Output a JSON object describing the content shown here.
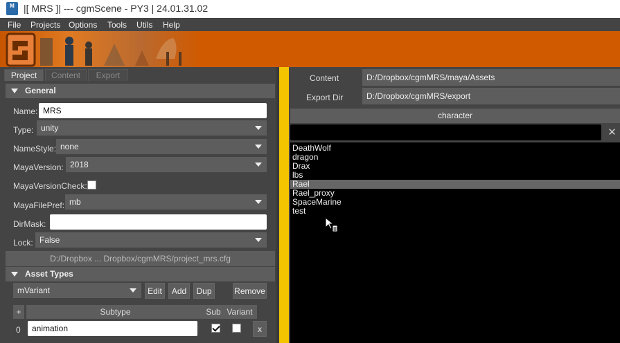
{
  "window": {
    "app_icon_text": "M",
    "title": "|[ MRS ]| --- cgmScene - PY3 | 24.01.31.02"
  },
  "menu": [
    "File",
    "Projects",
    "Options",
    "Tools",
    "Utils",
    "Help"
  ],
  "tabs": [
    "Project",
    "Content",
    "Export"
  ],
  "general": {
    "header": "General",
    "name_label": "Name:",
    "name_value": "MRS",
    "type_label": "Type:",
    "type_value": "unity",
    "namestyle_label": "NameStyle:",
    "namestyle_value": "none",
    "mayaversion_label": "MayaVersion:",
    "mayaversion_value": "2018",
    "mayaversioncheck_label": "MayaVersionCheck:",
    "mayafilepref_label": "MayaFilePref:",
    "mayafilepref_value": "mb",
    "dirmask_label": "DirMask:",
    "dirmask_value": "",
    "lock_label": "Lock:",
    "lock_value": "False",
    "config_path": "D:/Dropbox ... Dropbox/cgmMRS/project_mrs.cfg"
  },
  "asset_types": {
    "header": "Asset Types",
    "variant_select": "mVariant",
    "edit_label": "Edit",
    "add_label": "Add",
    "dup_label": "Dup",
    "remove_label": "Remove",
    "col_plus": "+",
    "col_subtype": "Subtype",
    "col_sub": "Sub",
    "col_variant": "Variant",
    "rows": [
      {
        "index": "0",
        "subtype": "animation",
        "delete_label": "x"
      }
    ]
  },
  "right": {
    "content_label": "Content",
    "content_value": "D:/Dropbox/cgmMRS/maya/Assets",
    "export_label": "Export Dir",
    "export_value": "D:/Dropbox/cgmMRS/export",
    "category": "character",
    "search_value": "",
    "clear_label": "✕",
    "items": [
      "DeathWolf",
      "dragon",
      "Drax",
      "lbs",
      "Rael",
      "Rael_proxy",
      "SpaceMarine",
      "test"
    ],
    "selected_index": 4
  },
  "colors": {
    "accent_orange": "#d05a00",
    "highlight_yellow": "#f5c400",
    "panel_gray": "#444444"
  }
}
